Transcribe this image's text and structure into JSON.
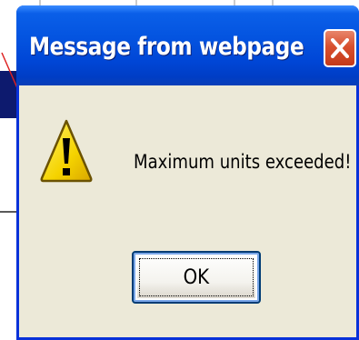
{
  "dialog": {
    "title": "Message from webpage",
    "message": "Maximum units exceeded!",
    "ok_label": "OK",
    "icon": "warning-icon",
    "close_icon": "close-icon"
  },
  "colors": {
    "titlebar": "#0454e0",
    "frame": "#0831D9",
    "body": "#ECE9D8",
    "close_button": "#d8502f",
    "warning_yellow": "#f5d300",
    "background_bar": "#0d1a6e"
  }
}
